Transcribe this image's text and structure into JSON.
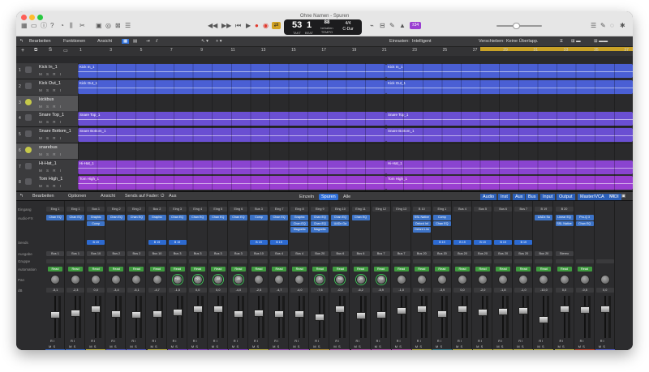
{
  "window": {
    "title": "Ohne Namen - Spuren"
  },
  "lcd": {
    "bar": "53",
    "beat": "1",
    "tempo": "88",
    "tempo_label": "behalten",
    "sig": "4/4",
    "key": "C-Dur",
    "bar_label": "TAKT",
    "beat_label": "BEAT",
    "tempo_unit": "TEMPO"
  },
  "toolbar": {
    "cycle_icon": "cycle-icon",
    "purple_badge": "±34"
  },
  "menubar": {
    "edit": "Bearbeiten",
    "functions": "Funktionen",
    "view": "Ansicht",
    "snap_label": "Einrasten:",
    "snap_value": "Intelligent",
    "drag_label": "Verschieben:",
    "drag_value": "Keine Überlapp."
  },
  "ruler": {
    "ticks": [
      "1",
      "3",
      "5",
      "7",
      "9",
      "11",
      "13",
      "15",
      "17",
      "19",
      "21",
      "23",
      "25",
      "27",
      "29",
      "31",
      "33",
      "35",
      "37"
    ]
  },
  "tracks": [
    {
      "num": "1",
      "name": "Kick In_1",
      "color": "#4a5fd4",
      "icon": "waveform-icon",
      "regions": [
        "Kick In_1",
        "Kick In_1"
      ]
    },
    {
      "num": "2",
      "name": "Kick Out_1",
      "color": "#4a5fd4",
      "icon": "waveform-icon",
      "regions": [
        "Kick Out_1",
        "Kick Out_1"
      ]
    },
    {
      "num": "3",
      "name": "kickbus",
      "color": "#3a3a3c",
      "icon": "bus-icon",
      "regions": []
    },
    {
      "num": "4",
      "name": "Snare Top_1",
      "color": "#6a4fd2",
      "icon": "waveform-icon",
      "regions": [
        "Snare Top_1",
        "Snare Top_1"
      ]
    },
    {
      "num": "5",
      "name": "Snare Bottom_1",
      "color": "#6a4fd2",
      "icon": "waveform-icon",
      "regions": [
        "Snare Bottom_1",
        "Snare Bottom_1"
      ]
    },
    {
      "num": "6",
      "name": "snarebus",
      "color": "#3a3a3c",
      "icon": "bus-icon",
      "regions": []
    },
    {
      "num": "7",
      "name": "Hi-Hat_1",
      "color": "#8a44d0",
      "icon": "waveform-icon",
      "regions": [
        "Hi-Hat_1",
        "Hi-Hat_1"
      ]
    },
    {
      "num": "8",
      "name": "Tom High_1",
      "color": "#9a3fd1",
      "icon": "waveform-icon",
      "regions": [
        "Tom High_1",
        "Tom High_1"
      ]
    }
  ],
  "mixer_bar": {
    "edit": "Bearbeiten",
    "options": "Optionen",
    "view": "Ansicht",
    "sends_on_fader": "Sends auf Fader:",
    "sends_value": "Aus",
    "single": "Einzeln",
    "tracks": "Spuren",
    "all": "Alle",
    "filters": [
      "Audio",
      "Inst",
      "Aux",
      "Bus",
      "Input",
      "Output",
      "Master/VCA",
      "MIDI"
    ]
  },
  "mixer_rows": {
    "input": "Eingang",
    "audiofx": "Audio-FX",
    "sends": "Sends",
    "output": "Ausgabe",
    "group": "Gruppe",
    "automation": "Automation",
    "pan": "Pan",
    "db": "dB"
  },
  "strips": [
    {
      "name": "Kick In_1",
      "input": "Eing 1",
      "fx": [
        "Chan EQ"
      ],
      "send": "",
      "output": "Bus 1",
      "auto": "Read",
      "pan": "",
      "db": "-5,1",
      "fader": 0.55
    },
    {
      "name": "Kick Out_1",
      "input": "Eing 1",
      "fx": [
        "Chan EQ"
      ],
      "send": "",
      "output": "Bus 1",
      "auto": "Read",
      "pan": "",
      "db": "-2,3",
      "fader": 0.6
    },
    {
      "name": "kickbus",
      "input": "Bus 1",
      "fx": [
        "Graphic",
        "Comp"
      ],
      "send": "B 19",
      "output": "Bus 10",
      "auto": "Read",
      "pan": "",
      "db": "0,0",
      "fader": 0.7
    },
    {
      "name": "Snare Top_1",
      "input": "Eing 2",
      "fx": [
        "Chan EQ"
      ],
      "send": "",
      "output": "Bus 2",
      "auto": "Read",
      "pan": "",
      "db": "-3,4",
      "fader": 0.58
    },
    {
      "name": "Snar...om_1",
      "input": "Eing 2",
      "fx": [
        "Chan EQ"
      ],
      "send": "",
      "output": "Bus 2",
      "auto": "Read",
      "pan": "",
      "db": "-5,1",
      "fader": 0.55
    },
    {
      "name": "snarebus",
      "input": "Bus 2",
      "fx": [
        "Graphic"
      ],
      "send": "B 19",
      "output": "Bus 10",
      "auto": "Read",
      "pan": "",
      "db": "-4,7",
      "fader": 0.57
    },
    {
      "name": "Hi-Hat_1",
      "input": "Eing 3",
      "fx": [
        "Chan EQ"
      ],
      "send": "B 19",
      "output": "Bus 3",
      "auto": "Read",
      "pan": "+18",
      "db": "-1,5",
      "fader": 0.62
    },
    {
      "name": "Tom High_1",
      "input": "Eing 4",
      "fx": [
        "Chan EQ"
      ],
      "send": "",
      "output": "Bus 3",
      "auto": "Read",
      "pan": "+21",
      "db": "0,0",
      "fader": 0.7
    },
    {
      "name": "Tom Mid_1",
      "input": "Eing 5",
      "fx": [
        "Chan EQ"
      ],
      "send": "",
      "output": "Bus 3",
      "auto": "Read",
      "pan": "-18",
      "db": "0,0",
      "fader": 0.7
    },
    {
      "name": "Tom Low_1",
      "input": "Eing 6",
      "fx": [
        "Chan EQ"
      ],
      "send": "",
      "output": "Bus 3",
      "auto": "Read",
      "pan": "-26",
      "db": "-4,0",
      "fader": 0.58
    },
    {
      "name": "tombus",
      "input": "Bus 3",
      "fx": [
        "Comp"
      ],
      "send": "B 19",
      "output": "Bus 10",
      "auto": "Read",
      "pan": "",
      "db": "-2,5",
      "fader": 0.6
    },
    {
      "name": "Over...ds_1",
      "input": "Eing 7",
      "fx": [
        "Chan EQ"
      ],
      "send": "B 19",
      "output": "Bus 4",
      "auto": "Read",
      "pan": "",
      "db": "-4,7",
      "fader": 0.57
    },
    {
      "name": "Liverpool_1",
      "input": "Eing 8",
      "fx": [
        "Graphic",
        "Chan EQ",
        "Magnetic"
      ],
      "send": "",
      "output": "Bus 4",
      "auto": "Read",
      "pan": "",
      "db": "-4,0",
      "fader": 0.58
    },
    {
      "name": "orgel",
      "input": "Eing 9",
      "fx": [
        "Chan EQ",
        "Chan EQ",
        "Magnetic"
      ],
      "send": "",
      "output": "Bus 20",
      "auto": "Read",
      "pan": "-54",
      "db": "-7,6",
      "fader": 0.5
    },
    {
      "name": "git",
      "input": "Eing 10",
      "fx": [
        "Chan EQ",
        "UADx Ga"
      ],
      "send": "",
      "output": "Bus 6",
      "auto": "Read",
      "pan": "+63",
      "db": "-0,0",
      "fader": 0.7
    },
    {
      "name": "Gitarre",
      "input": "Eing 11",
      "fx": [
        "Chan EQ"
      ],
      "send": "",
      "output": "Bus 6",
      "auto": "Read",
      "pan": "-29",
      "db": "-6,2",
      "fader": 0.54
    },
    {
      "name": "Holly...gs_2",
      "input": "Eing 12",
      "fx": [],
      "send": "",
      "output": "Bus 7",
      "auto": "Read",
      "pan": "+35",
      "db": "-5,9",
      "fader": 0.55
    },
    {
      "name": "Holly...rings",
      "input": "Eing 13",
      "fx": [],
      "send": "",
      "output": "Bus 7",
      "auto": "Read",
      "pan": "",
      "db": "-1,0",
      "fader": 0.65
    },
    {
      "name": "drumbus",
      "input": "B 10",
      "fx": [
        "SSL Native",
        "Oxford Inf",
        "Oxford Lim"
      ],
      "send": "",
      "output": "Bus 20",
      "auto": "Read",
      "pan": "",
      "db": "0,0",
      "fader": 0.7
    },
    {
      "name": "Room A_1",
      "input": "Eing 1",
      "fx": [
        "Comp",
        "Chan EQ"
      ],
      "send": "B 19",
      "output": "Bus 20",
      "auto": "Read",
      "pan": "",
      "db": "-3,9",
      "fader": 0.58
    },
    {
      "name": "bassbus",
      "input": "Bus 4",
      "fx": [],
      "send": "B 19",
      "output": "Bus 20",
      "auto": "Read",
      "pan": "",
      "db": "0,0",
      "fader": 0.7
    },
    {
      "name": "orgelbus",
      "input": "Bus 5",
      "fx": [],
      "send": "B 19",
      "output": "Bus 20",
      "auto": "Read",
      "pan": "",
      "db": "-2,0",
      "fader": 0.62
    },
    {
      "name": "gitbus",
      "input": "Bus 6",
      "fx": [],
      "send": "B 19",
      "output": "Bus 20",
      "auto": "Read",
      "pan": "",
      "db": "-1,8",
      "fader": 0.63
    },
    {
      "name": "stringbus",
      "input": "Bus 7",
      "fx": [],
      "send": "B 19",
      "output": "Bus 20",
      "auto": "Read",
      "pan": "",
      "db": "-1,0",
      "fader": 0.65
    },
    {
      "name": "soundcity",
      "input": "B 19",
      "fx": [
        "UADx Su"
      ],
      "send": "",
      "output": "Bus 20",
      "auto": "Read",
      "pan": "",
      "db": "-10,0",
      "fader": 0.45
    },
    {
      "name": "mixbus",
      "input": "B 20",
      "fx": [
        "Linear EQ",
        "SSL Native"
      ],
      "send": "",
      "output": "Stereo",
      "auto": "Read",
      "pan": "",
      "db": "0,0",
      "fader": 0.7
    },
    {
      "name": "Stereo Out",
      "input": "",
      "fx": [
        "Pro-Q 3",
        "Chan EQ"
      ],
      "send": "",
      "output": "",
      "auto": "Read",
      "pan": "",
      "db": "-0,5",
      "fader": 0.68
    },
    {
      "name": "Master",
      "input": "",
      "fx": [],
      "send": "",
      "output": "",
      "auto": "",
      "pan": "",
      "db": "0,0",
      "fader": 0.7
    }
  ],
  "strip_name_colors": [
    "#3d6fd0",
    "#3d6fd0",
    "#c9c04a",
    "#5a63d6",
    "#5a63d6",
    "#c9c04a",
    "#7c48d2",
    "#8a44d0",
    "#8a44d0",
    "#8a44d0",
    "#c9c04a",
    "#a44fc7",
    "#a44fc7",
    "#c8a23f",
    "#c45bb9",
    "#c45bb9",
    "#c45bb9",
    "#c45bb9",
    "#c9c04a",
    "#3f8f9f",
    "#c9c04a",
    "#c9c04a",
    "#c9c04a",
    "#c9c04a",
    "#c9c04a",
    "#c9c04a",
    "#d04c2f",
    "#5a63d6"
  ]
}
